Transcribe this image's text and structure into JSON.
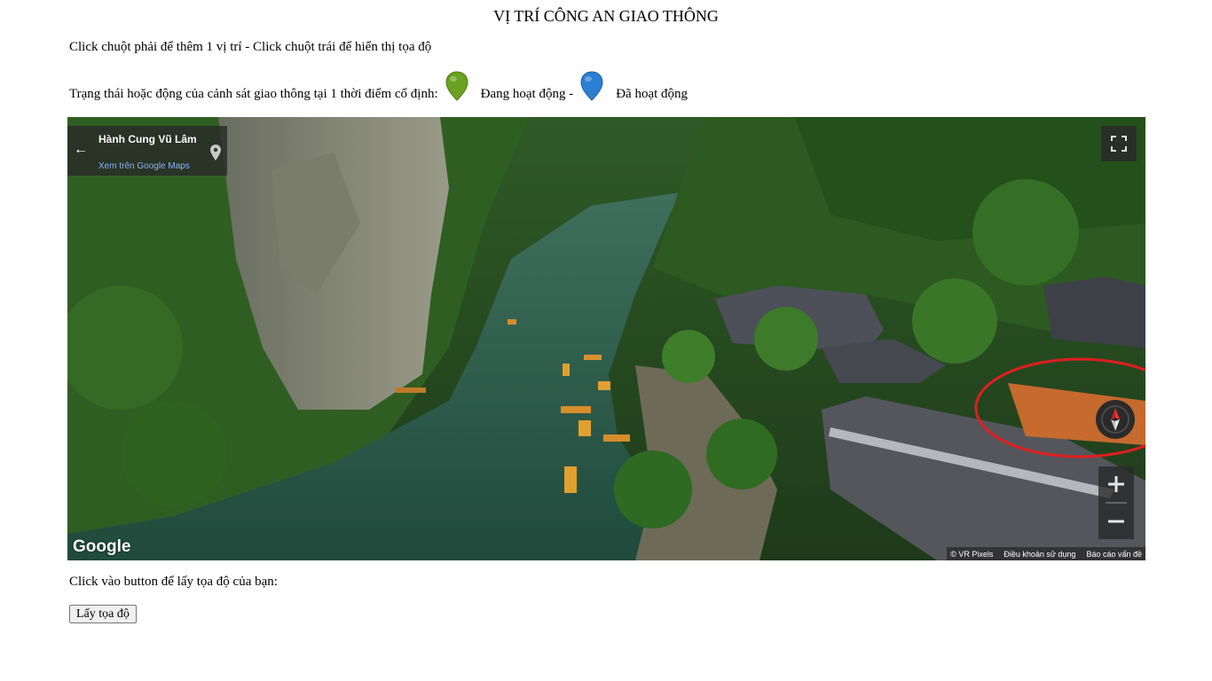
{
  "title": "VỊ TRÍ CÔNG AN GIAO THÔNG",
  "instructions": "Click chuột phải để thêm 1 vị trí - Click chuột trái để hiển thị tọa độ",
  "status": {
    "prefix": "Trạng thái hoặc động của cảnh sát giao thông tại 1 thời điểm cố định:",
    "active_label": "Đang hoạt động -",
    "inactive_label": "Đã hoạt động",
    "active_color": "#6aa121",
    "inactive_color": "#2a7fd4"
  },
  "streetview": {
    "place_name": "Hành Cung Vũ Lâm",
    "maps_link": "Xem trên Google Maps",
    "logo": "Google",
    "footer": [
      "© VR Pixels",
      "Điều khoản sử dụng",
      "Báo cáo vấn đề"
    ],
    "icons": [
      "back-arrow-icon",
      "location-pin-icon",
      "fullscreen-icon",
      "compass-icon",
      "zoom-in-icon",
      "zoom-out-icon"
    ],
    "highlight_color": "#e01e1e"
  },
  "get_coords": {
    "label": "Click vào button để lấy tọa độ của bạn:",
    "button": "Lấy tọa độ"
  }
}
